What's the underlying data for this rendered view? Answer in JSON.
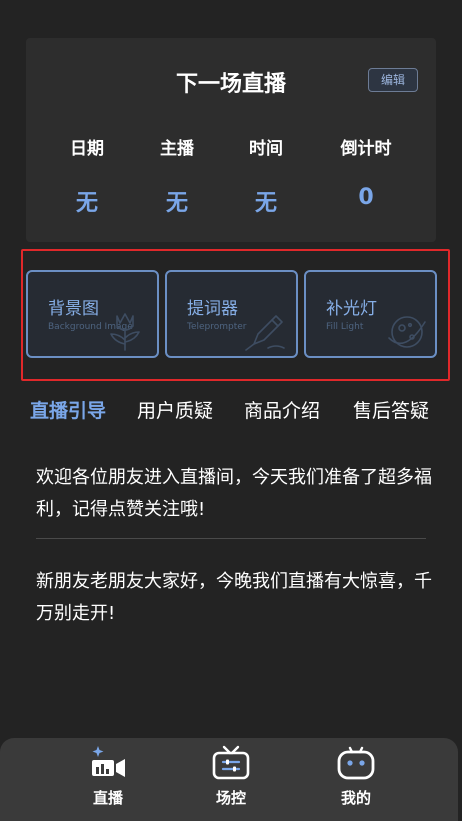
{
  "next_live": {
    "title": "下一场直播",
    "edit_label": "编辑",
    "stats": [
      {
        "label": "日期",
        "value": "无"
      },
      {
        "label": "主播",
        "value": "无"
      },
      {
        "label": "时间",
        "value": "无"
      },
      {
        "label": "倒计时",
        "value": "0"
      }
    ]
  },
  "tiles": [
    {
      "title": "背景图",
      "subtitle": "Background Image",
      "icon": "tulip-icon"
    },
    {
      "title": "提词器",
      "subtitle": "Teleprompter",
      "icon": "pen-icon"
    },
    {
      "title": "补光灯",
      "subtitle": "Fill Light",
      "icon": "planet-icon"
    }
  ],
  "tabs": [
    {
      "label": "直播引导",
      "active": true
    },
    {
      "label": "用户质疑",
      "active": false
    },
    {
      "label": "商品介绍",
      "active": false
    },
    {
      "label": "售后答疑",
      "active": false
    }
  ],
  "scripts": [
    "欢迎各位朋友进入直播间，今天我们准备了超多福利，记得点赞关注哦!",
    "新朋友老朋友大家好，今晚我们直播有大惊喜，千万别走开!"
  ],
  "bottom_nav": [
    {
      "label": "直播",
      "icon": "live-camera-icon"
    },
    {
      "label": "场控",
      "icon": "tv-control-icon"
    },
    {
      "label": "我的",
      "icon": "robot-face-icon"
    }
  ],
  "colors": {
    "background": "#232323",
    "card": "#2d2d2d",
    "accent": "#7aa6e8",
    "tile_border": "#6b8fc4",
    "highlight_frame": "#e0282a",
    "nav_bar": "#3a3a3a"
  }
}
